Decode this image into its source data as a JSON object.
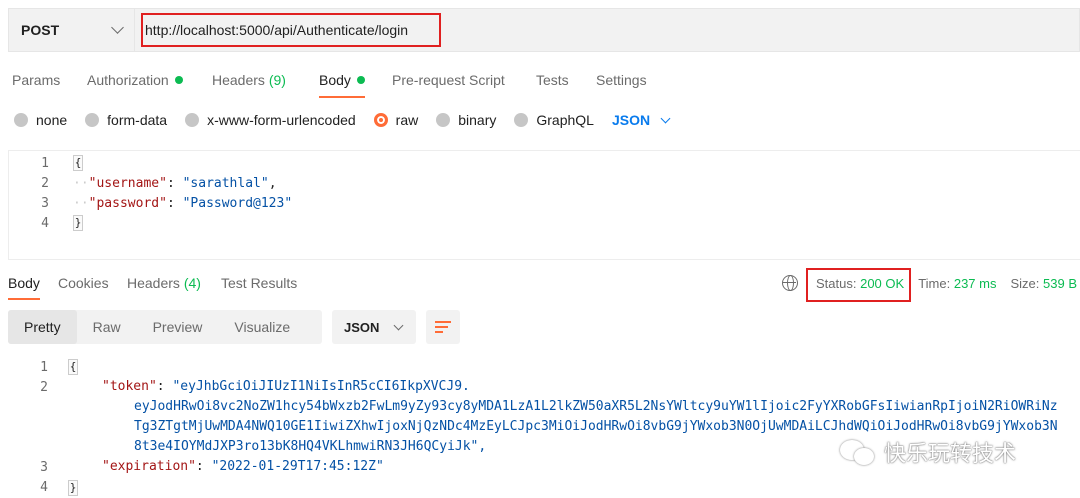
{
  "request": {
    "method": "POST",
    "url": "http://localhost:5000/api/Authenticate/login"
  },
  "request_tabs": [
    {
      "label": "Params"
    },
    {
      "label": "Authorization"
    },
    {
      "label": "Headers",
      "count": "(9)"
    },
    {
      "label": "Body"
    },
    {
      "label": "Pre-request Script"
    },
    {
      "label": "Tests"
    },
    {
      "label": "Settings"
    }
  ],
  "body_types": [
    "none",
    "form-data",
    "x-www-form-urlencoded",
    "raw",
    "binary",
    "GraphQL"
  ],
  "body_format": "JSON",
  "request_body": {
    "line_numbers": [
      "1",
      "2",
      "3",
      "4"
    ],
    "open_brace": "{",
    "close_brace": "}",
    "username_key": "\"username\"",
    "username_value": "\"sarathlal\"",
    "password_key": "\"password\"",
    "password_value": "\"Password@123\""
  },
  "response_tabs": [
    {
      "label": "Body"
    },
    {
      "label": "Cookies"
    },
    {
      "label": "Headers",
      "count": "(4)"
    },
    {
      "label": "Test Results"
    }
  ],
  "response_meta": {
    "status_label": "Status:",
    "status_value": "200 OK",
    "time_label": "Time:",
    "time_value": "237 ms",
    "size_label": "Size:",
    "size_value": "539 B"
  },
  "response_views": [
    "Pretty",
    "Raw",
    "Preview",
    "Visualize"
  ],
  "response_format": "JSON",
  "response_body": {
    "line_numbers": [
      "1",
      "2",
      "3",
      "4"
    ],
    "open_brace": "{",
    "close_brace": "}",
    "token_key": "\"token\"",
    "token_line1": "\"eyJhbGciOiJIUzI1NiIsInR5cCI6IkpXVCJ9.",
    "token_line2": "eyJodHRwOi8vc2NoZW1hcy54bWxzb2FwLm9yZy93cy8yMDA1LzA1L2lkZW50aXR5L2NsYWltcy9uYW1lIjoic2FyYXRobGFsIiwianRpIjoiN2RiOWRiNz",
    "token_line3": "Tg3ZTgtMjUwMDA4NWQ10GE1IiwiZXhwIjoxNjQzNDc4MzEyLCJpc3MiOiJodHRwOi8vbG9jYWxob3N0OjUwMDAiLCJhdWQiOiJodHRwOi8vbG9jYWxob3N",
    "token_line4": "8t3e4IOYMdJXP3ro13bK8HQ4VKLhmwiRN3JH6QCyiJk\",",
    "expiration_key": "\"expiration\"",
    "expiration_value": "\"2022-01-29T17:45:12Z\""
  },
  "watermark": {
    "text": "快乐玩转技术"
  },
  "colors": {
    "accent": "#ff6c37",
    "success": "#0cbb52",
    "link": "#097bed",
    "highlight_box": "#e02020"
  }
}
